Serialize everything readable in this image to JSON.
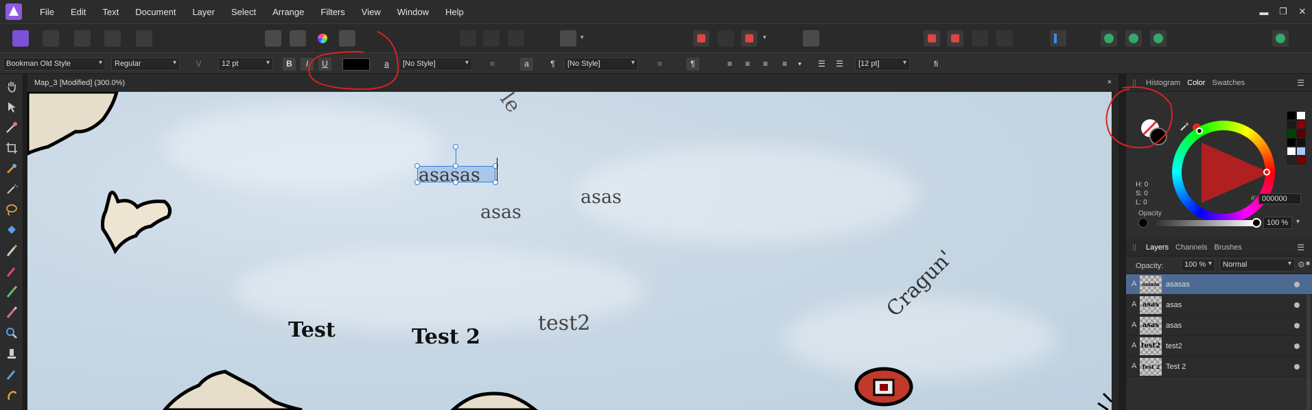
{
  "menu": {
    "items": [
      "File",
      "Edit",
      "Text",
      "Document",
      "Layer",
      "Select",
      "Arrange",
      "Filters",
      "View",
      "Window",
      "Help"
    ],
    "window_controls": [
      "▬",
      "❐",
      "✕"
    ]
  },
  "context": {
    "font_family": "Bookman Old Style",
    "font_style": "Regular",
    "font_size": "12 pt",
    "bold": "B",
    "italic": "I",
    "underline": "U",
    "char_style_glyph": "a",
    "char_style": "[No Style]",
    "para_style_glyph": "a",
    "pilcrow": "¶",
    "para_style": "[No Style]",
    "para_pilcrow": "¶",
    "leading": "[12 pt]",
    "ligature": "fi"
  },
  "document": {
    "tab_title": "Map_3 [Modified] (300.0%)",
    "close": "×"
  },
  "canvas": {
    "selected_text": "asasas",
    "asas_1": "asas",
    "asas_2": "asas",
    "test": "Test",
    "test2_bold": "Test 2",
    "test2": "test2",
    "cragun": "Cragun'",
    "top_text": "le"
  },
  "color_panel": {
    "tabs": [
      "Histogram",
      "Color",
      "Swatches"
    ],
    "active_tab": "Color",
    "h": "H: 0",
    "s": "S: 0",
    "l": "L: 0",
    "hash": "#:",
    "hex": "000000",
    "opacity_label": "Opacity",
    "opacity": "100 %",
    "fill_color": "#000000",
    "accent_red": "#e02020",
    "swatches": [
      "#000000",
      "#ffffff",
      "#1a1a1a",
      "#8b0000",
      "#004400",
      "#550000",
      "#000000",
      "#111111",
      "#ffffff",
      "#a8c8ff",
      "#222222",
      "#770000"
    ]
  },
  "layers_panel": {
    "tabs": [
      "Layers",
      "Channels",
      "Brushes"
    ],
    "active_tab": "Layers",
    "opacity_label": "Opacity:",
    "opacity": "100 %",
    "blend_mode": "Normal",
    "rows": [
      {
        "type": "A",
        "thumb": "asasas",
        "name": "asasas",
        "selected": true
      },
      {
        "type": "A",
        "thumb": "asas",
        "name": "asas",
        "selected": false
      },
      {
        "type": "A",
        "thumb": "asas",
        "name": "asas",
        "selected": false
      },
      {
        "type": "A",
        "thumb": "test2",
        "name": "test2",
        "selected": false
      },
      {
        "type": "A",
        "thumb": "Test 2",
        "name": "Test 2",
        "selected": false
      }
    ]
  }
}
